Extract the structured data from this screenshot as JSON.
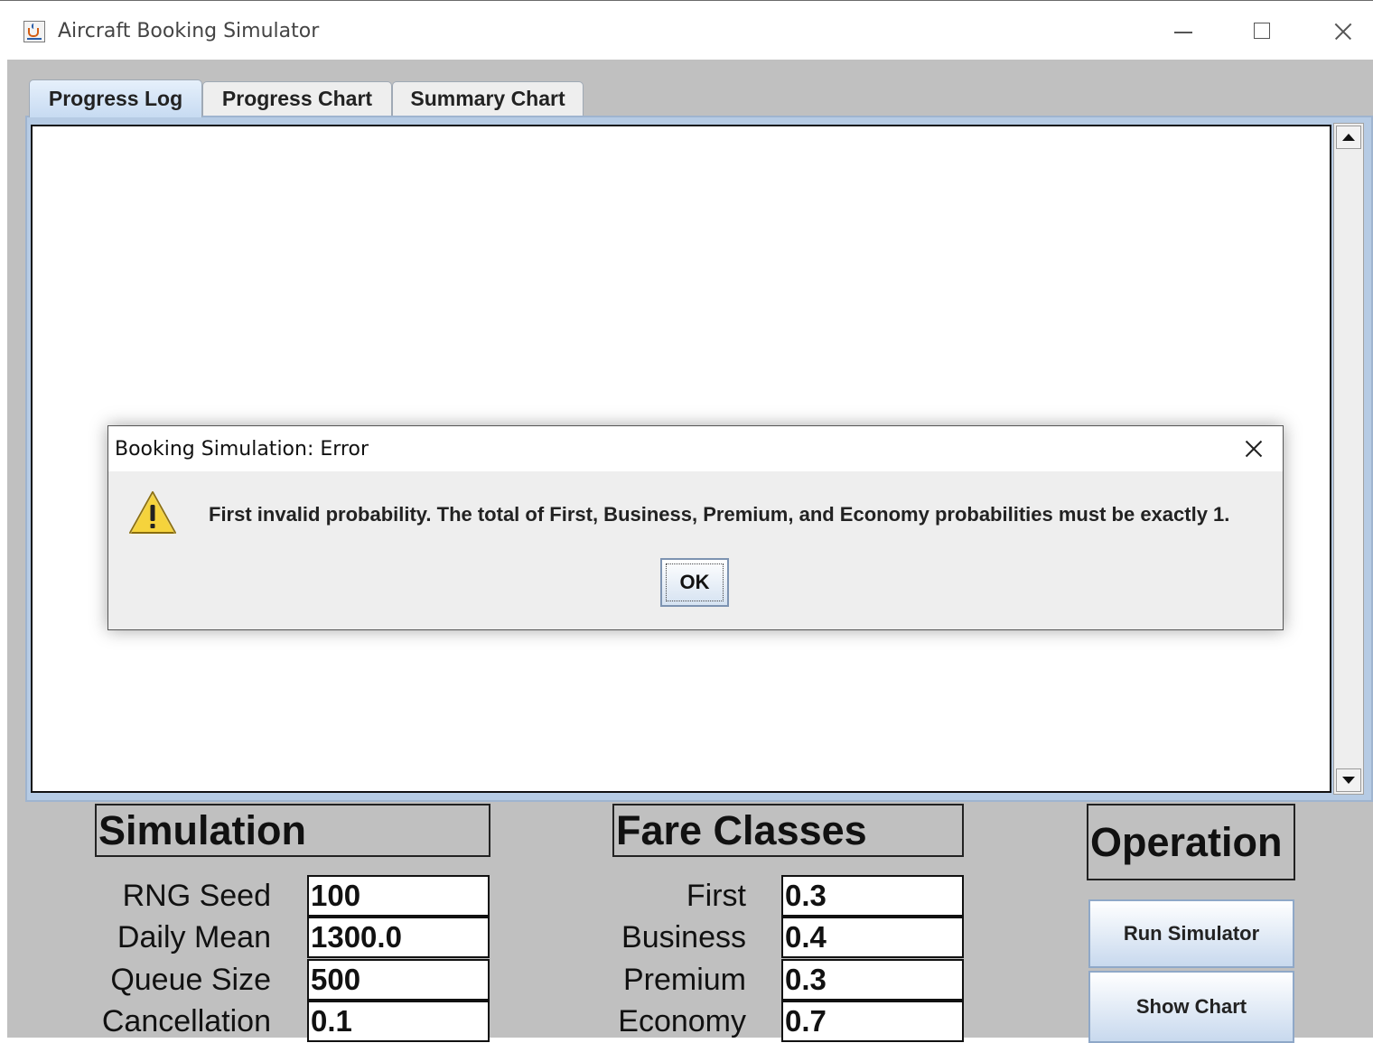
{
  "window": {
    "title": "Aircraft Booking Simulator",
    "icon": "java-cup-icon"
  },
  "tabs": [
    {
      "label": "Progress Log",
      "active": true
    },
    {
      "label": "Progress Chart",
      "active": false
    },
    {
      "label": "Summary Chart",
      "active": false
    }
  ],
  "progress_log": {
    "content": ""
  },
  "simulation": {
    "header": "Simulation",
    "fields": [
      {
        "label": "RNG Seed",
        "value": "100"
      },
      {
        "label": "Daily Mean",
        "value": "1300.0"
      },
      {
        "label": "Queue Size",
        "value": "500"
      },
      {
        "label": "Cancellation",
        "value": "0.1"
      }
    ]
  },
  "fare_classes": {
    "header": "Fare Classes",
    "fields": [
      {
        "label": "First",
        "value": "0.3"
      },
      {
        "label": "Business",
        "value": "0.4"
      },
      {
        "label": "Premium",
        "value": "0.3"
      },
      {
        "label": "Economy",
        "value": "0.7"
      }
    ]
  },
  "operation": {
    "header": "Operation",
    "run_label": "Run Simulator",
    "show_label": "Show Chart"
  },
  "dialog": {
    "title": "Booking Simulation: Error",
    "message": "First invalid probability. The total of First, Business, Premium, and Economy probabilities must be exactly 1.",
    "ok_label": "OK",
    "icon": "warning-icon"
  },
  "colors": {
    "client_bg": "#c0c0c0",
    "tab_active": "#c7dbf2",
    "warning_yellow": "#f5d33c"
  }
}
